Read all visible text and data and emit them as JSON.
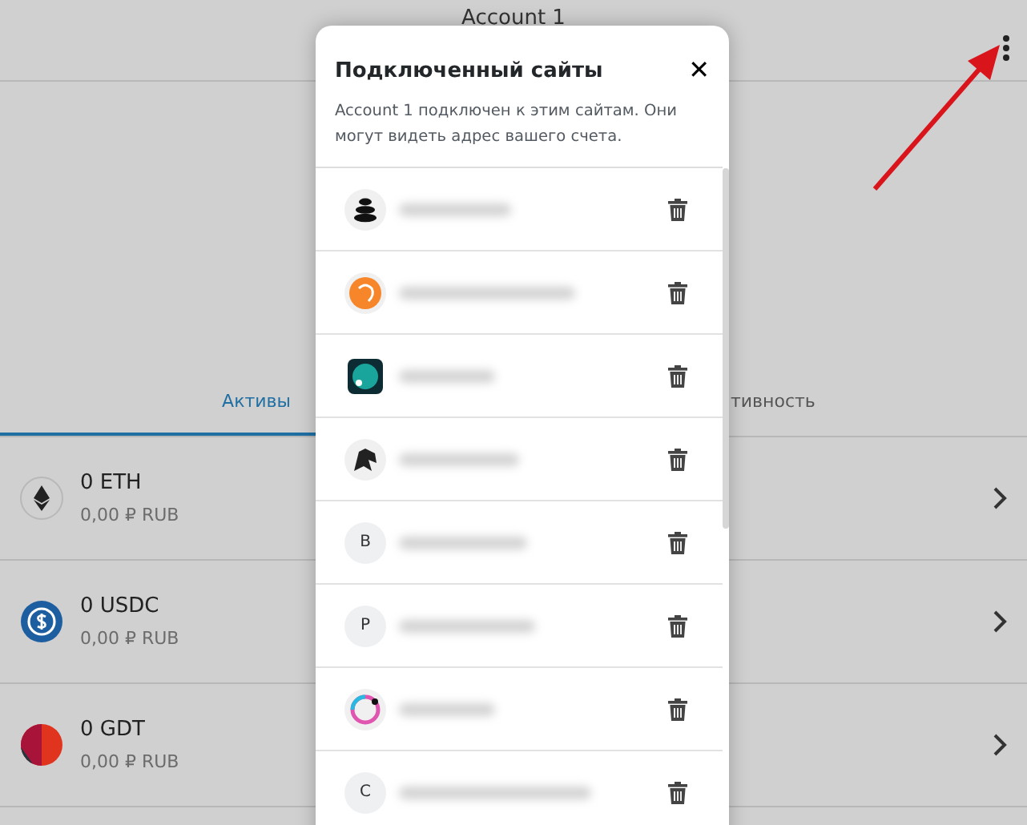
{
  "header": {
    "account_name": "Account 1"
  },
  "tabs": [
    {
      "label": "Активы",
      "selected": true
    },
    {
      "label": "тивность",
      "selected": false
    }
  ],
  "assets": [
    {
      "amount": "0 ETH",
      "value": "0,00 ₽ RUB"
    },
    {
      "amount": "0 USDC",
      "value": "0,00 ₽ RUB"
    },
    {
      "amount": "0 GDT",
      "value": "0,00 ₽ RUB"
    }
  ],
  "modal": {
    "title": "Подключенный сайты",
    "close": "✕",
    "description": "Account 1 подключен к этим сайтам. Они могут видеть адрес вашего счета.",
    "sites": [
      {
        "kind": "logo"
      },
      {
        "kind": "logo"
      },
      {
        "kind": "logo"
      },
      {
        "kind": "logo"
      },
      {
        "kind": "letter",
        "letter": "B"
      },
      {
        "kind": "letter",
        "letter": "P"
      },
      {
        "kind": "logo"
      },
      {
        "kind": "letter",
        "letter": "C"
      }
    ]
  }
}
